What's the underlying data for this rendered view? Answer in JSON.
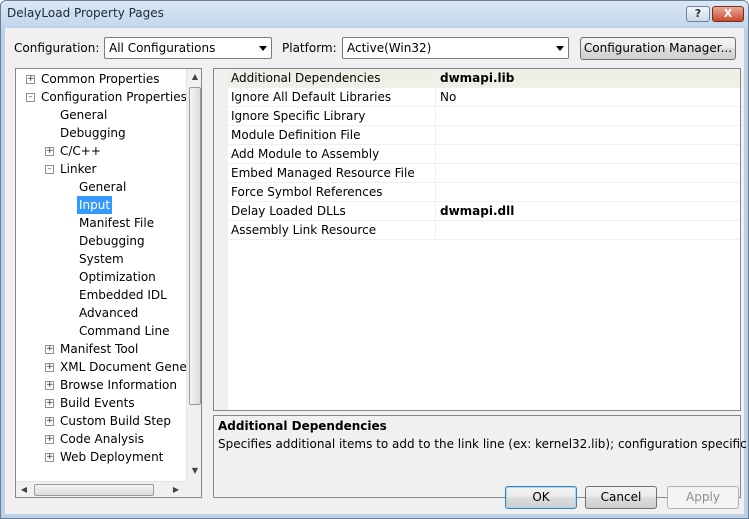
{
  "window": {
    "title": "DelayLoad Property Pages",
    "help_label": "?",
    "close_label": "X"
  },
  "toolbar": {
    "configuration_label": "Configuration:",
    "configuration_value": "All Configurations",
    "platform_label": "Platform:",
    "platform_value": "Active(Win32)",
    "config_manager_label": "Configuration Manager..."
  },
  "tree": {
    "items": [
      {
        "label": "Common Properties",
        "expander": "+"
      },
      {
        "label": "Configuration Properties",
        "expander": "-"
      },
      {
        "label": "General"
      },
      {
        "label": "Debugging"
      },
      {
        "label": "C/C++",
        "expander": "+"
      },
      {
        "label": "Linker",
        "expander": "-"
      },
      {
        "label": "General"
      },
      {
        "label": "Input",
        "selected": true
      },
      {
        "label": "Manifest File"
      },
      {
        "label": "Debugging"
      },
      {
        "label": "System"
      },
      {
        "label": "Optimization"
      },
      {
        "label": "Embedded IDL"
      },
      {
        "label": "Advanced"
      },
      {
        "label": "Command Line"
      },
      {
        "label": "Manifest Tool",
        "expander": "+"
      },
      {
        "label": "XML Document Genera",
        "expander": "+"
      },
      {
        "label": "Browse Information",
        "expander": "+"
      },
      {
        "label": "Build Events",
        "expander": "+"
      },
      {
        "label": "Custom Build Step",
        "expander": "+"
      },
      {
        "label": "Code Analysis",
        "expander": "+"
      },
      {
        "label": "Web Deployment",
        "expander": "+"
      }
    ]
  },
  "grid": {
    "rows": [
      {
        "name": "Additional Dependencies",
        "value": "dwmapi.lib",
        "bold": true,
        "selected": true
      },
      {
        "name": "Ignore All Default Libraries",
        "value": "No"
      },
      {
        "name": "Ignore Specific Library",
        "value": ""
      },
      {
        "name": "Module Definition File",
        "value": ""
      },
      {
        "name": "Add Module to Assembly",
        "value": ""
      },
      {
        "name": "Embed Managed Resource File",
        "value": ""
      },
      {
        "name": "Force Symbol References",
        "value": ""
      },
      {
        "name": "Delay Loaded DLLs",
        "value": "dwmapi.dll",
        "bold": true
      },
      {
        "name": "Assembly Link Resource",
        "value": ""
      }
    ]
  },
  "description": {
    "title": "Additional Dependencies",
    "text": "Specifies additional items to add to the link line (ex: kernel32.lib); configuration specific."
  },
  "buttons": {
    "ok": "OK",
    "cancel": "Cancel",
    "apply": "Apply"
  },
  "colors": {
    "selection": "#3399ff",
    "window_frame": "#bcd0e6",
    "dialog_bg": "#f0f0f0"
  }
}
